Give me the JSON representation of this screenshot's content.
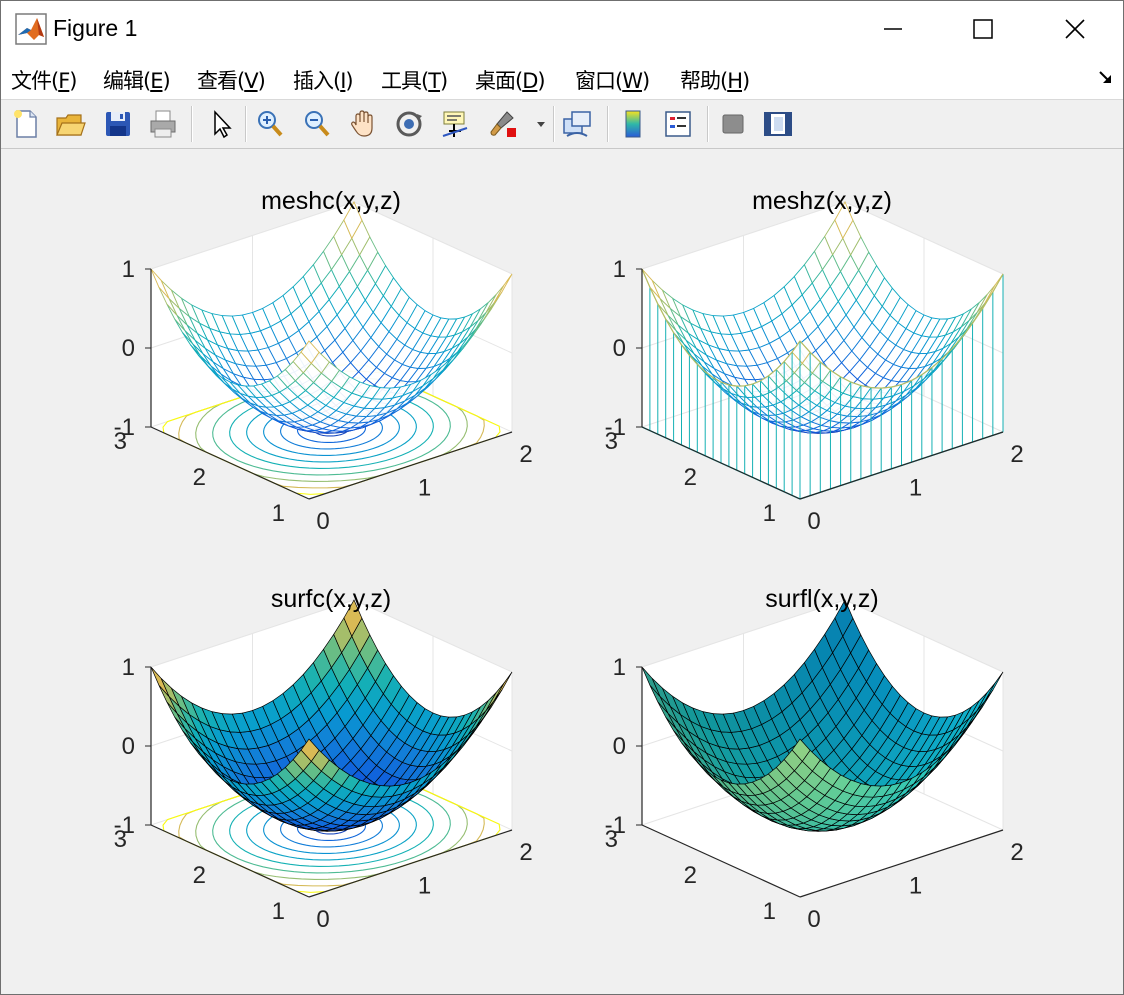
{
  "window": {
    "title": "Figure 1"
  },
  "menu": [
    {
      "label": "文件(",
      "key": "F",
      "end": ")"
    },
    {
      "label": "编辑(",
      "key": "E",
      "end": ")"
    },
    {
      "label": "查看(",
      "key": "V",
      "end": ")"
    },
    {
      "label": "插入(",
      "key": "I",
      "end": ")"
    },
    {
      "label": "工具(",
      "key": "T",
      "end": ")"
    },
    {
      "label": "桌面(",
      "key": "D",
      "end": ")"
    },
    {
      "label": "窗口(",
      "key": "W",
      "end": ")"
    },
    {
      "label": "帮助(",
      "key": "H",
      "end": ")"
    }
  ],
  "toolbar": {
    "buttons": [
      "new-figure-icon",
      "open-icon",
      "save-icon",
      "print-icon",
      "select-arrow-icon",
      "zoom-in-icon",
      "zoom-out-icon",
      "pan-hand-icon",
      "rotate-3d-icon",
      "data-cursor-icon",
      "brush-icon",
      "brush-dropdown-icon",
      "link-plot-icon",
      "colorbar-icon",
      "legend-icon",
      "hide-plot-tools-icon",
      "show-plot-tools-icon"
    ]
  },
  "chart_data": [
    {
      "type": "mesh",
      "variant": "meshc",
      "title": "meshc(x,y,z)",
      "x_ticks": [
        "0",
        "1",
        "2"
      ],
      "y_ticks": [
        "1",
        "2",
        "3"
      ],
      "z_ticks": [
        "-1",
        "0",
        "1"
      ],
      "xlim": [
        0,
        2
      ],
      "ylim": [
        1,
        3
      ],
      "zlim": [
        -1,
        1
      ],
      "surface": "paraboloid, minimum at center of grid, maximum ≈ 1 at corners",
      "contours_below": true,
      "colormap": "parula"
    },
    {
      "type": "mesh",
      "variant": "meshz",
      "title": "meshz(x,y,z)",
      "x_ticks": [
        "0",
        "1",
        "2"
      ],
      "y_ticks": [
        "1",
        "2",
        "3"
      ],
      "z_ticks": [
        "-1",
        "0",
        "1"
      ],
      "xlim": [
        0,
        2
      ],
      "ylim": [
        1,
        3
      ],
      "zlim": [
        -1,
        1
      ],
      "surface": "paraboloid with curtain to z = -1",
      "colormap": "parula"
    },
    {
      "type": "surface",
      "variant": "surfc",
      "title": "surfc(x,y,z)",
      "x_ticks": [
        "0",
        "1",
        "2"
      ],
      "y_ticks": [
        "1",
        "2",
        "3"
      ],
      "z_ticks": [
        "-1",
        "0",
        "1"
      ],
      "xlim": [
        0,
        2
      ],
      "ylim": [
        1,
        3
      ],
      "zlim": [
        -1,
        1
      ],
      "surface": "paraboloid, filled faces with black edges",
      "contours_below": true,
      "colormap": "parula"
    },
    {
      "type": "surface",
      "variant": "surfl",
      "title": "surfl(x,y,z)",
      "x_ticks": [
        "0",
        "1",
        "2"
      ],
      "y_ticks": [
        "1",
        "2",
        "3"
      ],
      "z_ticks": [
        "-1",
        "0",
        "1"
      ],
      "xlim": [
        0,
        2
      ],
      "ylim": [
        1,
        3
      ],
      "zlim": [
        -1,
        1
      ],
      "surface": "paraboloid with lighting",
      "colormap": "parula"
    }
  ],
  "colors": {
    "parula_low": "#1560d6",
    "parula_mid": "#1fb5a9",
    "parula_high": "#f9e11e",
    "edge": "#000000"
  }
}
